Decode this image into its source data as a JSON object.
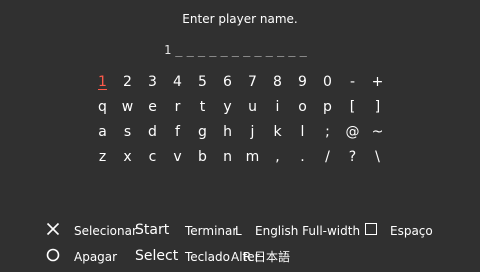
{
  "prompt": "Enter player name.",
  "name_field": {
    "slots": [
      "1",
      "_",
      "_",
      "_",
      "_",
      "_",
      "_",
      "_",
      "_",
      "_",
      "_",
      "_",
      "_"
    ]
  },
  "keyboard": {
    "rows": [
      [
        "1",
        "2",
        "3",
        "4",
        "5",
        "6",
        "7",
        "8",
        "9",
        "0",
        "-",
        "+"
      ],
      [
        "q",
        "w",
        "e",
        "r",
        "t",
        "y",
        "u",
        "i",
        "o",
        "p",
        "[",
        "]"
      ],
      [
        "a",
        "s",
        "d",
        "f",
        "g",
        "h",
        "j",
        "k",
        "l",
        ";",
        "@",
        "~"
      ],
      [
        "z",
        "x",
        "c",
        "v",
        "b",
        "n",
        "m",
        ",",
        ".",
        "/",
        "?",
        "\\"
      ]
    ],
    "selected_key": "1",
    "selected_color": "#ff5a4a"
  },
  "legend": {
    "cross_icon": "cross-button-icon",
    "circle_icon": "circle-button-icon",
    "square_icon": "square-button-icon",
    "select_label": "Selecionar",
    "start_button": "Start",
    "finish_label": "Terminar",
    "l_button": "L",
    "english_fullwidth": "English Full-width",
    "space_label": "Espaço",
    "delete_label": "Apagar",
    "select_button": "Select",
    "keyboard_label": "Teclado",
    "alter_label": "Alter",
    "r_button": "R",
    "japanese_label": "日本語"
  },
  "colors": {
    "background": "#303030",
    "text": "#ffffff",
    "highlight": "#ff5a4a"
  }
}
